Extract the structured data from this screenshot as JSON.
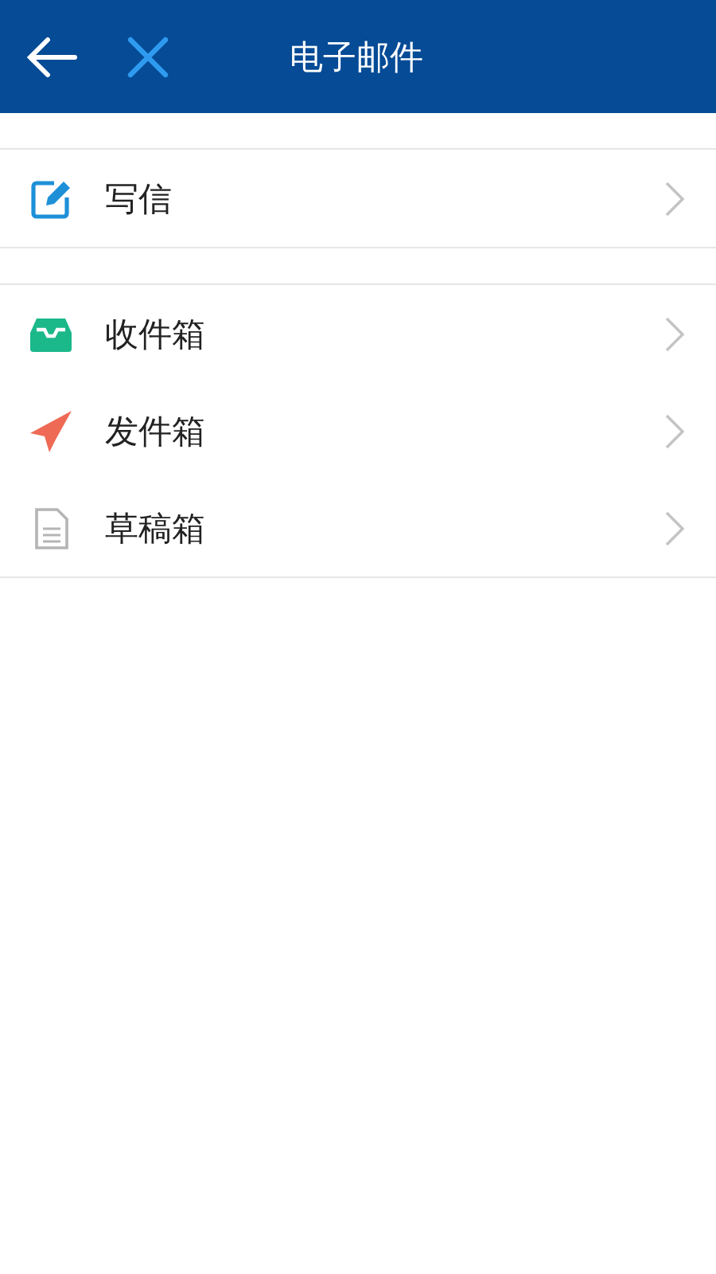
{
  "header": {
    "title": "电子邮件"
  },
  "groups": [
    {
      "items": [
        {
          "kind": "compose",
          "label": "写信"
        }
      ]
    },
    {
      "items": [
        {
          "kind": "inbox",
          "label": "收件箱"
        },
        {
          "kind": "sent",
          "label": "发件箱"
        },
        {
          "kind": "draft",
          "label": "草稿箱"
        }
      ]
    }
  ]
}
